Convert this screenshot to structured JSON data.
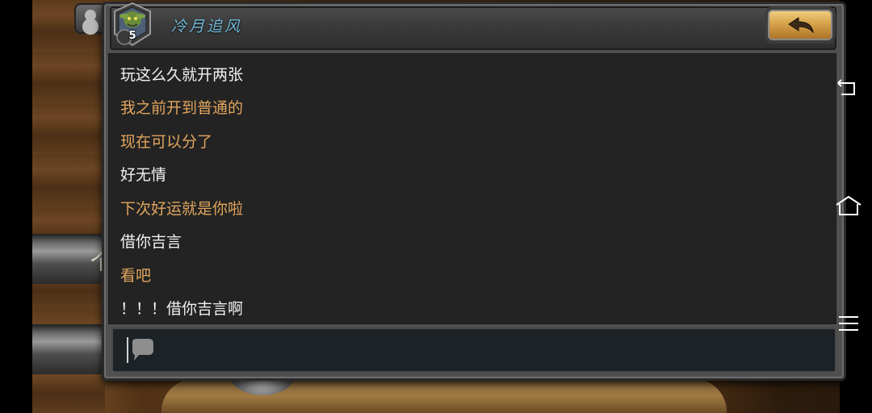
{
  "chat": {
    "friend_name": "冷月追风",
    "rank": "5",
    "messages": [
      {
        "text": "玩这么久就开两张",
        "sender": "self"
      },
      {
        "text": "我之前开到普通的",
        "sender": "friend"
      },
      {
        "text": "现在可以分了",
        "sender": "friend"
      },
      {
        "text": "好无情",
        "sender": "self"
      },
      {
        "text": "下次好运就是你啦",
        "sender": "friend"
      },
      {
        "text": "借你吉言",
        "sender": "self"
      },
      {
        "text": "看吧",
        "sender": "friend"
      },
      {
        "text": "！！！借你吉言啊",
        "sender": "self"
      }
    ],
    "input": {
      "value": ""
    }
  },
  "background": {
    "glyph": "个"
  },
  "colors": {
    "self_text": "#f2f2f2",
    "friend_text": "#e1a55d",
    "name_text": "#6fb7d6",
    "back_button": "#d6a24a"
  },
  "icons": {
    "back_button": "undo-arrow-icon",
    "rank": "goblin-rank-badge-icon",
    "chat": "chat-bubble-icon",
    "nav_back": "nav-back-icon",
    "nav_home": "nav-home-icon",
    "nav_menu": "nav-menu-icon",
    "profile": "friends-icon"
  }
}
